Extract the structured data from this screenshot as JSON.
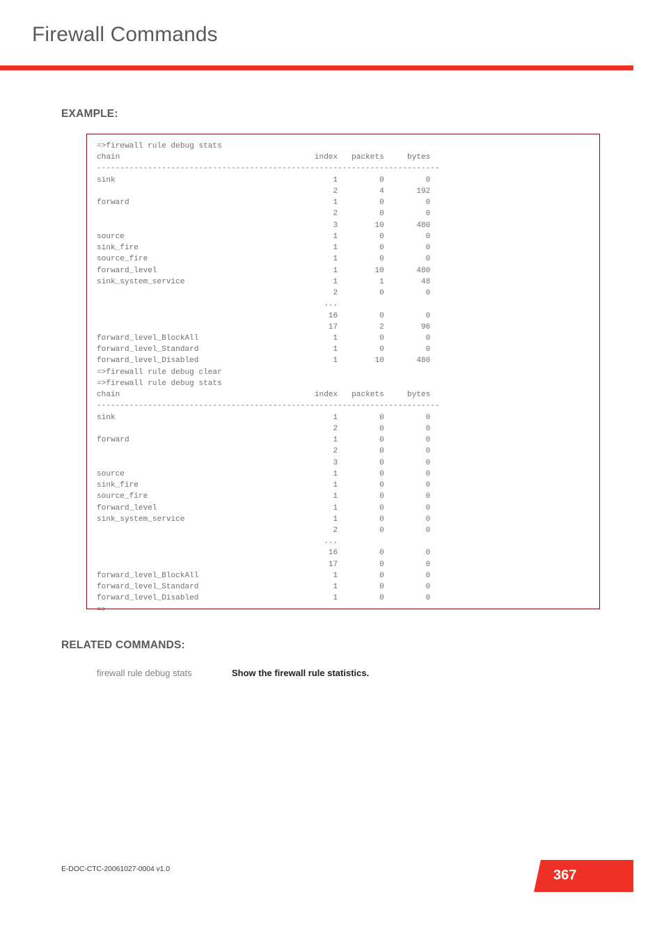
{
  "header": {
    "title": "Firewall Commands",
    "accent_color": "#ee3124"
  },
  "sections": {
    "example_heading": "EXAMPLE:",
    "related_heading": "RELATED COMMANDS:"
  },
  "code_block": {
    "border_color": "#7d0f11",
    "text_color": "#6f7072",
    "columns": [
      "chain",
      "index",
      "packets",
      "bytes"
    ],
    "prompt": "=>",
    "commands": [
      "firewall rule debug stats",
      "firewall rule debug clear",
      "firewall rule debug stats"
    ],
    "separator": "--------------------------------------------------------------------------",
    "trailing_prompt": "=>",
    "outputs": [
      {
        "command": "=>firewall rule debug stats",
        "rows": [
          {
            "chain": "sink",
            "index": "1",
            "packets": "0",
            "bytes": "0"
          },
          {
            "chain": "",
            "index": "2",
            "packets": "4",
            "bytes": "192"
          },
          {
            "chain": "forward",
            "index": "1",
            "packets": "0",
            "bytes": "0"
          },
          {
            "chain": "",
            "index": "2",
            "packets": "0",
            "bytes": "0"
          },
          {
            "chain": "",
            "index": "3",
            "packets": "10",
            "bytes": "480"
          },
          {
            "chain": "source",
            "index": "1",
            "packets": "0",
            "bytes": "0"
          },
          {
            "chain": "sink_fire",
            "index": "1",
            "packets": "0",
            "bytes": "0"
          },
          {
            "chain": "source_fire",
            "index": "1",
            "packets": "0",
            "bytes": "0"
          },
          {
            "chain": "forward_level",
            "index": "1",
            "packets": "10",
            "bytes": "480"
          },
          {
            "chain": "sink_system_service",
            "index": "1",
            "packets": "1",
            "bytes": "48"
          },
          {
            "chain": "",
            "index": "2",
            "packets": "0",
            "bytes": "0"
          },
          {
            "chain": "",
            "index": "...",
            "packets": "",
            "bytes": ""
          },
          {
            "chain": "",
            "index": "16",
            "packets": "0",
            "bytes": "0"
          },
          {
            "chain": "",
            "index": "17",
            "packets": "2",
            "bytes": "96"
          },
          {
            "chain": "forward_level_BlockAll",
            "index": "1",
            "packets": "0",
            "bytes": "0"
          },
          {
            "chain": "forward_level_Standard",
            "index": "1",
            "packets": "0",
            "bytes": "0"
          },
          {
            "chain": "forward_level_Disabled",
            "index": "1",
            "packets": "10",
            "bytes": "480"
          }
        ]
      },
      {
        "command": "=>firewall rule debug stats",
        "rows": [
          {
            "chain": "sink",
            "index": "1",
            "packets": "0",
            "bytes": "0"
          },
          {
            "chain": "",
            "index": "2",
            "packets": "0",
            "bytes": "0"
          },
          {
            "chain": "forward",
            "index": "1",
            "packets": "0",
            "bytes": "0"
          },
          {
            "chain": "",
            "index": "2",
            "packets": "0",
            "bytes": "0"
          },
          {
            "chain": "",
            "index": "3",
            "packets": "0",
            "bytes": "0"
          },
          {
            "chain": "source",
            "index": "1",
            "packets": "0",
            "bytes": "0"
          },
          {
            "chain": "sink_fire",
            "index": "1",
            "packets": "0",
            "bytes": "0"
          },
          {
            "chain": "source_fire",
            "index": "1",
            "packets": "0",
            "bytes": "0"
          },
          {
            "chain": "forward_level",
            "index": "1",
            "packets": "0",
            "bytes": "0"
          },
          {
            "chain": "sink_system_service",
            "index": "1",
            "packets": "0",
            "bytes": "0"
          },
          {
            "chain": "",
            "index": "2",
            "packets": "0",
            "bytes": "0"
          },
          {
            "chain": "",
            "index": "...",
            "packets": "",
            "bytes": ""
          },
          {
            "chain": "",
            "index": "16",
            "packets": "0",
            "bytes": "0"
          },
          {
            "chain": "",
            "index": "17",
            "packets": "0",
            "bytes": "0"
          },
          {
            "chain": "forward_level_BlockAll",
            "index": "1",
            "packets": "0",
            "bytes": "0"
          },
          {
            "chain": "forward_level_Standard",
            "index": "1",
            "packets": "0",
            "bytes": "0"
          },
          {
            "chain": "forward_level_Disabled",
            "index": "1",
            "packets": "0",
            "bytes": "0"
          }
        ]
      }
    ],
    "text": "=>firewall rule debug stats\nchain                                          index   packets     bytes\n--------------------------------------------------------------------------\nsink                                               1         0         0\n                                                   2         4       192\nforward                                            1         0         0\n                                                   2         0         0\n                                                   3        10       480\nsource                                             1         0         0\nsink_fire                                          1         0         0\nsource_fire                                        1         0         0\nforward_level                                      1        10       480\nsink_system_service                                1         1        48\n                                                   2         0         0\n                                                 ...\n                                                  16         0         0\n                                                  17         2        96\nforward_level_BlockAll                             1         0         0\nforward_level_Standard                             1         0         0\nforward_level_Disabled                             1        10       480\n=>firewall rule debug clear\n=>firewall rule debug stats\nchain                                          index   packets     bytes\n--------------------------------------------------------------------------\nsink                                               1         0         0\n                                                   2         0         0\nforward                                            1         0         0\n                                                   2         0         0\n                                                   3         0         0\nsource                                             1         0         0\nsink_fire                                          1         0         0\nsource_fire                                        1         0         0\nforward_level                                      1         0         0\nsink_system_service                                1         0         0\n                                                   2         0         0\n                                                 ...\n                                                  16         0         0\n                                                  17         0         0\nforward_level_BlockAll                             1         0         0\nforward_level_Standard                             1         0         0\nforward_level_Disabled                             1         0         0\n=>"
  },
  "related_commands": [
    {
      "command": "firewall rule debug stats",
      "description": "Show the firewall rule statistics."
    }
  ],
  "footer": {
    "doc_id": "E-DOC-CTC-20061027-0004 v1.0",
    "page_number": "367"
  }
}
